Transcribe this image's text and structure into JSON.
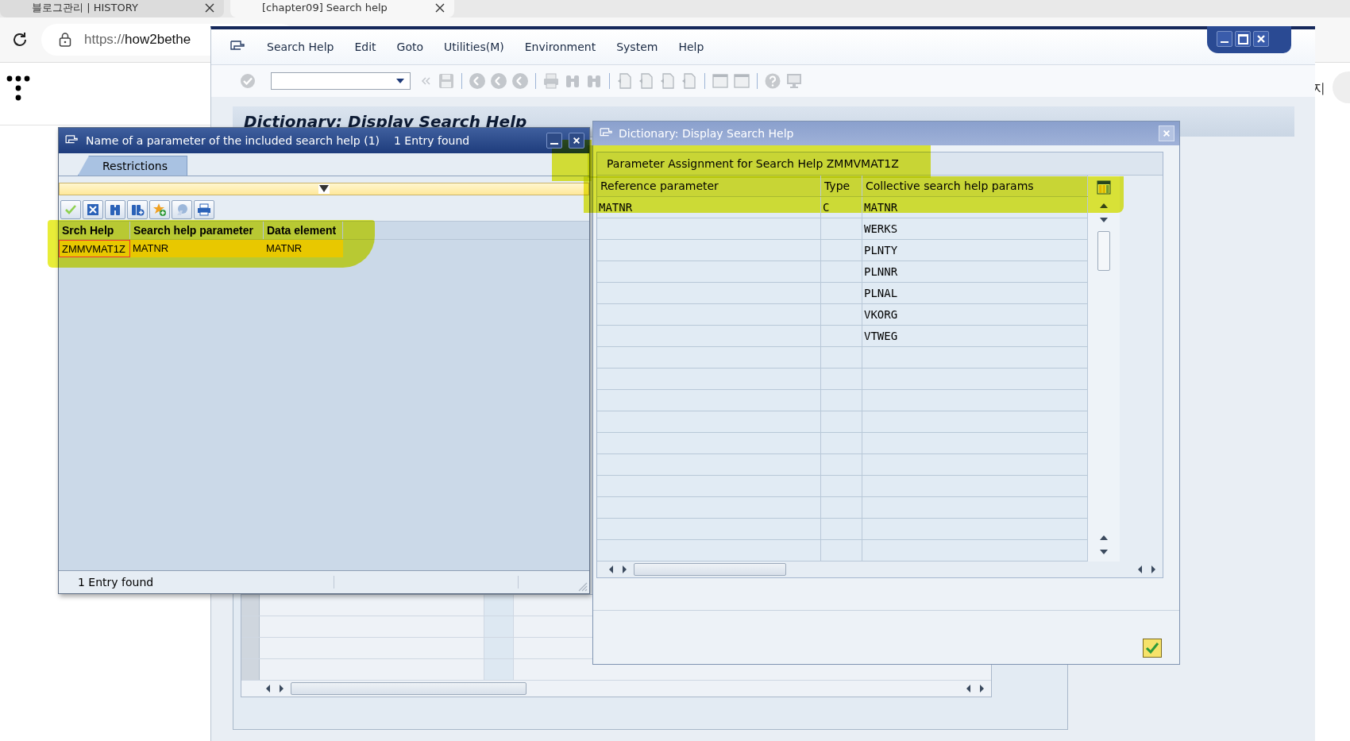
{
  "browser": {
    "tabs": [
      {
        "title": "블로그관리 | HISTORY",
        "selected": false
      },
      {
        "title": "[chapter09] Search help",
        "selected": true
      }
    ],
    "url_scheme": "https://",
    "url_host": "how2bethe",
    "side_text": "지"
  },
  "sap": {
    "menu": [
      "Search Help",
      "Edit",
      "Goto",
      "Utilities(M)",
      "Environment",
      "System",
      "Help"
    ],
    "title": "Dictionary: Display Search Help"
  },
  "left_dialog": {
    "title": "Name of a parameter of the included search help (1)",
    "count": "1 Entry found",
    "tab": "Restrictions",
    "columns": [
      "Srch Help",
      "Search help parameter",
      "Data element"
    ],
    "rows": [
      {
        "cells": [
          "ZMMVMAT1Z",
          "MATNR",
          "MATNR"
        ],
        "selected": true
      }
    ],
    "status": "1 Entry found"
  },
  "right_dialog": {
    "title": "Dictionary: Display Search Help",
    "group_title": "Parameter Assignment for Search Help ZMMVMAT1Z",
    "columns": [
      "Reference parameter",
      "Type",
      "Collective search help params"
    ],
    "rows": [
      {
        "reference": "MATNR",
        "type": "C",
        "param": "MATNR"
      },
      {
        "param": "WERKS"
      },
      {
        "param": "PLNTY"
      },
      {
        "param": "PLNNR"
      },
      {
        "param": "PLNAL"
      },
      {
        "param": "VKORG"
      },
      {
        "param": "VTWEG"
      }
    ]
  }
}
